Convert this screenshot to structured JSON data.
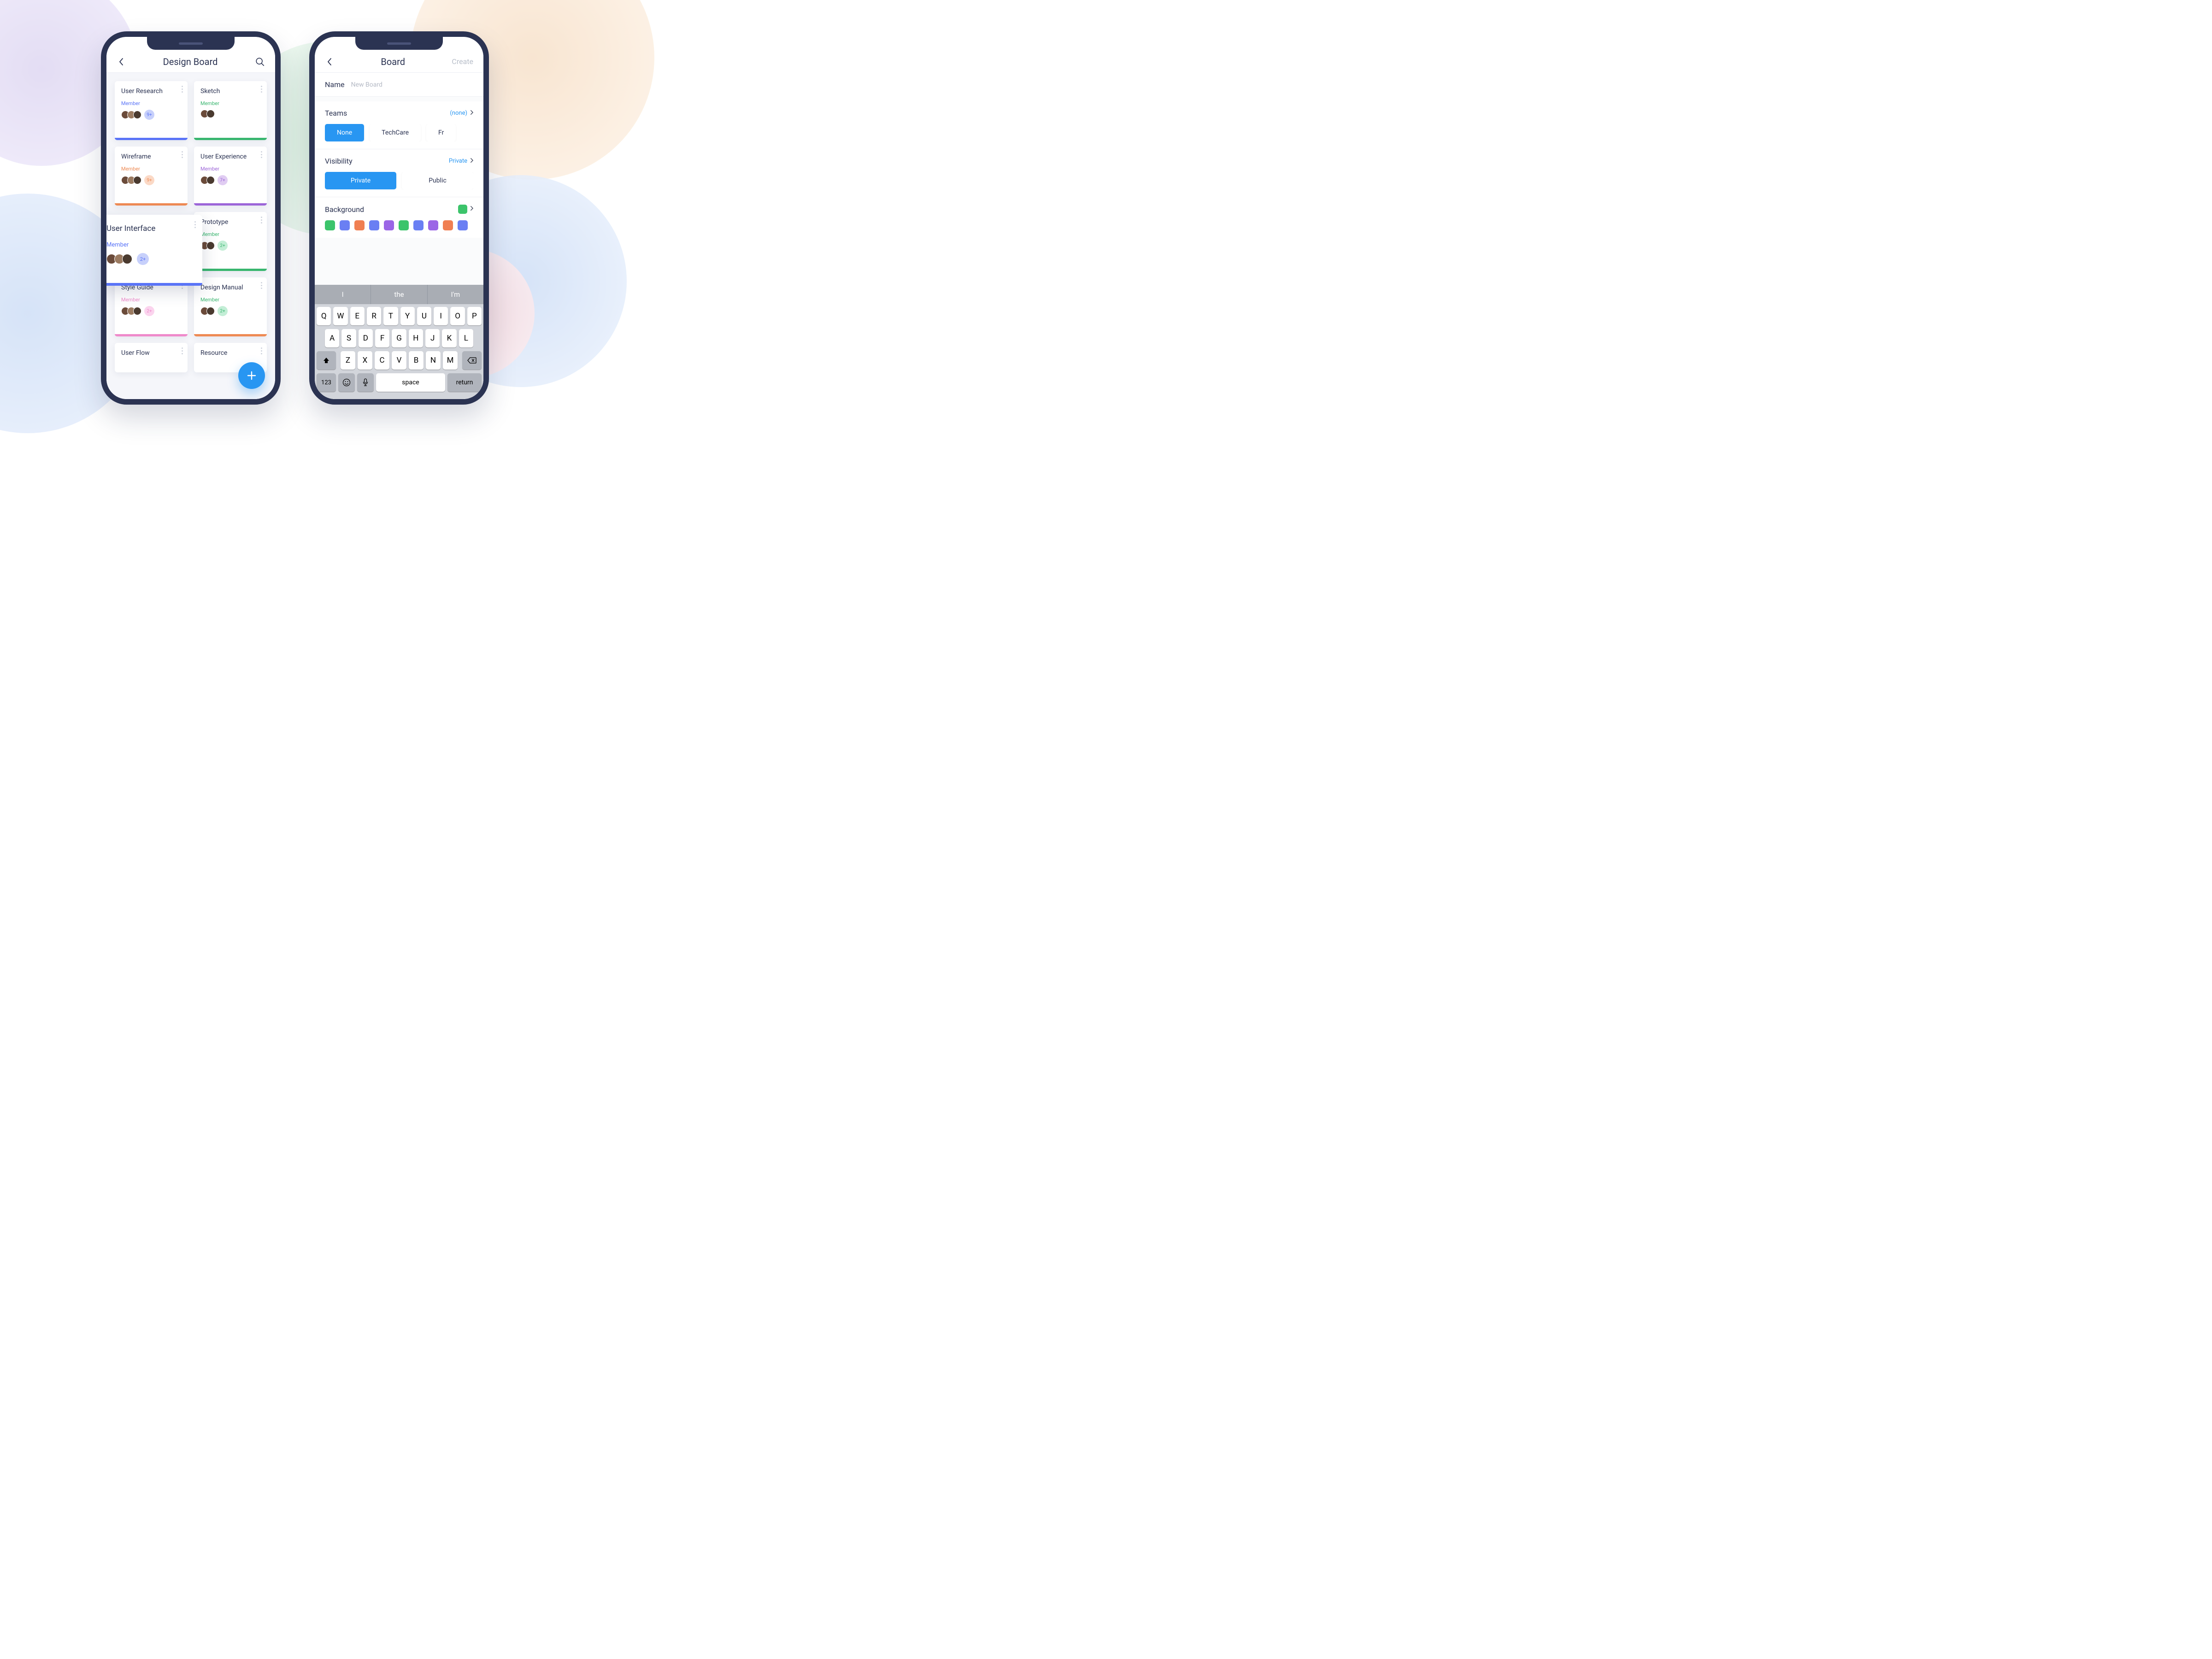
{
  "left": {
    "header_title": "Design Board",
    "cards": [
      {
        "title": "User Research",
        "member": "Member",
        "badge": "9+"
      },
      {
        "title": "Sketch",
        "member": "Member"
      },
      {
        "title": "Wireframe",
        "member": "Member",
        "badge": "9+"
      },
      {
        "title": "User Experience",
        "member": "Member",
        "badge": "7+"
      },
      {
        "title": "User Interface",
        "member": "Member",
        "badge": "2+"
      },
      {
        "title": "Prototype",
        "member": "Member",
        "badge": "2+"
      },
      {
        "title": "Style Guide",
        "member": "Member",
        "badge": "2+"
      },
      {
        "title": "Design Manual",
        "member": "Member",
        "badge": "2+"
      },
      {
        "title": "User Flow"
      },
      {
        "title": "Resource"
      }
    ]
  },
  "right": {
    "header_title": "Board",
    "create_label": "Create",
    "name_label": "Name",
    "name_placeholder": "New Board",
    "teams_label": "Teams",
    "teams_value": "(none)",
    "team_pills": [
      "None",
      "TechCare",
      "Fr"
    ],
    "visibility_label": "Visibility",
    "visibility_value": "Private",
    "visibility_pills": [
      "Private",
      "Public"
    ],
    "background_label": "Background",
    "kbd_suggestions": [
      "I",
      "the",
      "I'm"
    ],
    "kbd_rows": [
      [
        "Q",
        "W",
        "E",
        "R",
        "T",
        "Y",
        "U",
        "I",
        "O",
        "P"
      ],
      [
        "A",
        "S",
        "D",
        "F",
        "G",
        "H",
        "J",
        "K",
        "L"
      ],
      [
        "Z",
        "X",
        "C",
        "V",
        "B",
        "N",
        "M"
      ]
    ],
    "kbd_123": "123",
    "kbd_space": "space",
    "kbd_return": "return"
  }
}
